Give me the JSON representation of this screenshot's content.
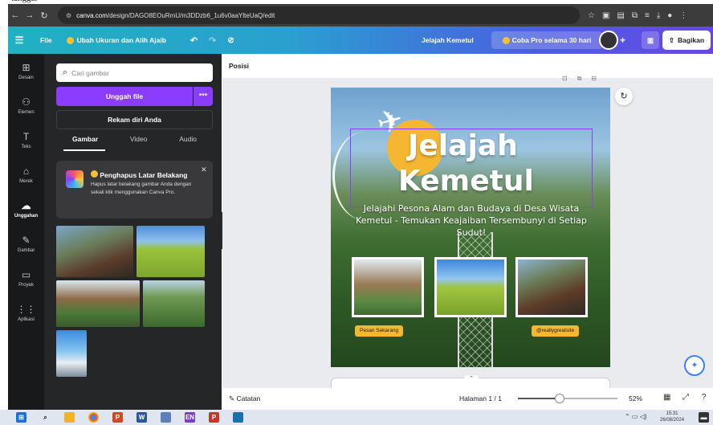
{
  "browser": {
    "url_host": "canva.com",
    "url_path": "/design/DAGO8EOuRmU/m3DDzb6_1u6v0aaYlteUaQ/edit"
  },
  "header": {
    "file": "File",
    "resize": "Ubah Ukuran dan Alih Ajaib",
    "title": "Jelajah Kemetul",
    "pro": "Coba Pro selama 30 hari",
    "share": "Bagikan",
    "plus": "+"
  },
  "rail": [
    {
      "label": "Desain",
      "icon": "layout-icon",
      "glyph": "⊞"
    },
    {
      "label": "Elemen",
      "icon": "shapes-icon",
      "glyph": "⚇"
    },
    {
      "label": "Teks",
      "icon": "text-icon",
      "glyph": "T"
    },
    {
      "label": "Merek",
      "icon": "brand-icon",
      "glyph": "⌂"
    },
    {
      "label": "Unggahan",
      "icon": "upload-cloud-icon",
      "glyph": "☁"
    },
    {
      "label": "Gambar",
      "icon": "draw-icon",
      "glyph": "✎"
    },
    {
      "label": "Proyek",
      "icon": "folder-icon",
      "glyph": "▭"
    },
    {
      "label": "Aplikasi",
      "icon": "apps-icon",
      "glyph": "⋮⋮"
    }
  ],
  "panel": {
    "search_placeholder": "Cari gambar",
    "upload": "Unggah file",
    "upload_more": "•••",
    "record": "Rekam diri Anda",
    "tabs": [
      "Gambar",
      "Video",
      "Audio"
    ],
    "promo_title": "Penghapus Latar Belakang",
    "promo_body": "Hapus latar belakang gambar Anda dengan sekali klik menggunakan Canva Pro."
  },
  "work": {
    "posisi": "Posisi"
  },
  "design": {
    "title_line1": "Jelajah",
    "title_line2": "Kemetul",
    "subtitle": "Jelajahi Pesona Alam dan Budaya di Desa Wisata Kemetul - Temukan Keajaiban Tersembunyi di Setiap Sudut!",
    "btn_left": "Pesan Sekarang",
    "btn_right": "@reallygreatsite"
  },
  "bottom": {
    "notes": "Catatan",
    "pages": "Halaman 1 / 1",
    "zoom": "52%",
    "zoom_level": 0.42
  },
  "taskbar": {
    "time": "15:31",
    "date": "26/08/2024"
  }
}
